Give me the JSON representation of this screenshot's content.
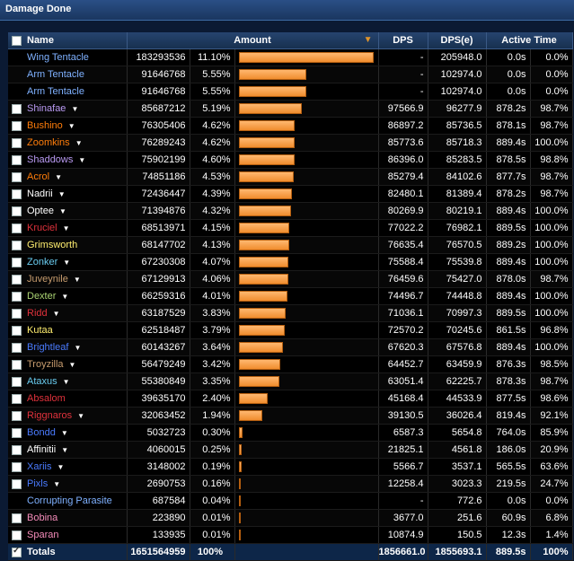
{
  "window": {
    "title": "Damage Done"
  },
  "columns": {
    "name": "Name",
    "amount": "Amount",
    "dps": "DPS",
    "dpse": "DPS(e)",
    "active": "Active Time"
  },
  "max_amount": 183293536,
  "rows": [
    {
      "name": "Wing Tentacle",
      "color": "#7fb1ff",
      "checkbox": false,
      "menu": false,
      "amount": "183293536",
      "pct": "11.10%",
      "value": 183293536,
      "dps": "-",
      "dpse": "205948.0",
      "time": "0.0s",
      "active": "0.0%"
    },
    {
      "name": "Arm Tentacle",
      "color": "#7fb1ff",
      "checkbox": false,
      "menu": false,
      "amount": "91646768",
      "pct": "5.55%",
      "value": 91646768,
      "dps": "-",
      "dpse": "102974.0",
      "time": "0.0s",
      "active": "0.0%"
    },
    {
      "name": "Arm Tentacle",
      "color": "#7fb1ff",
      "checkbox": false,
      "menu": false,
      "amount": "91646768",
      "pct": "5.55%",
      "value": 91646768,
      "dps": "-",
      "dpse": "102974.0",
      "time": "0.0s",
      "active": "0.0%"
    },
    {
      "name": "Shinafae",
      "color": "#b99af2",
      "checkbox": true,
      "menu": true,
      "amount": "85687212",
      "pct": "5.19%",
      "value": 85687212,
      "dps": "97566.9",
      "dpse": "96277.9",
      "time": "878.2s",
      "active": "98.7%"
    },
    {
      "name": "Bushino",
      "color": "#ff7d0a",
      "checkbox": true,
      "menu": true,
      "amount": "76305406",
      "pct": "4.62%",
      "value": 76305406,
      "dps": "86897.2",
      "dpse": "85736.5",
      "time": "878.1s",
      "active": "98.7%"
    },
    {
      "name": "Zoomkins",
      "color": "#ff7d0a",
      "checkbox": true,
      "menu": true,
      "amount": "76289243",
      "pct": "4.62%",
      "value": 76289243,
      "dps": "85773.6",
      "dpse": "85718.3",
      "time": "889.4s",
      "active": "100.0%"
    },
    {
      "name": "Shaddows",
      "color": "#b99af2",
      "checkbox": true,
      "menu": true,
      "amount": "75902199",
      "pct": "4.60%",
      "value": 75902199,
      "dps": "86396.0",
      "dpse": "85283.5",
      "time": "878.5s",
      "active": "98.8%"
    },
    {
      "name": "Acrol",
      "color": "#ff7d0a",
      "checkbox": true,
      "menu": true,
      "amount": "74851186",
      "pct": "4.53%",
      "value": 74851186,
      "dps": "85279.4",
      "dpse": "84102.6",
      "time": "877.7s",
      "active": "98.7%"
    },
    {
      "name": "Nadrii",
      "color": "#ffffff",
      "checkbox": true,
      "menu": true,
      "amount": "72436447",
      "pct": "4.39%",
      "value": 72436447,
      "dps": "82480.1",
      "dpse": "81389.4",
      "time": "878.2s",
      "active": "98.7%"
    },
    {
      "name": "Optee",
      "color": "#ffffff",
      "checkbox": true,
      "menu": true,
      "amount": "71394876",
      "pct": "4.32%",
      "value": 71394876,
      "dps": "80269.9",
      "dpse": "80219.1",
      "time": "889.4s",
      "active": "100.0%"
    },
    {
      "name": "Kruciel",
      "color": "#e0323c",
      "checkbox": true,
      "menu": true,
      "amount": "68513971",
      "pct": "4.15%",
      "value": 68513971,
      "dps": "77022.2",
      "dpse": "76982.1",
      "time": "889.5s",
      "active": "100.0%"
    },
    {
      "name": "Grimsworth",
      "color": "#ffee6f",
      "checkbox": true,
      "menu": false,
      "amount": "68147702",
      "pct": "4.13%",
      "value": 68147702,
      "dps": "76635.4",
      "dpse": "76570.5",
      "time": "889.2s",
      "active": "100.0%"
    },
    {
      "name": "Zonker",
      "color": "#69ccf0",
      "checkbox": true,
      "menu": true,
      "amount": "67230308",
      "pct": "4.07%",
      "value": 67230308,
      "dps": "75588.4",
      "dpse": "75539.8",
      "time": "889.4s",
      "active": "100.0%"
    },
    {
      "name": "Juveynile",
      "color": "#c79c6e",
      "checkbox": true,
      "menu": true,
      "amount": "67129913",
      "pct": "4.06%",
      "value": 67129913,
      "dps": "76459.6",
      "dpse": "75427.0",
      "time": "878.0s",
      "active": "98.7%"
    },
    {
      "name": "Dexter",
      "color": "#abd473",
      "checkbox": true,
      "menu": true,
      "amount": "66259316",
      "pct": "4.01%",
      "value": 66259316,
      "dps": "74496.7",
      "dpse": "74448.8",
      "time": "889.4s",
      "active": "100.0%"
    },
    {
      "name": "Ridd",
      "color": "#e0323c",
      "checkbox": true,
      "menu": true,
      "amount": "63187529",
      "pct": "3.83%",
      "value": 63187529,
      "dps": "71036.1",
      "dpse": "70997.3",
      "time": "889.5s",
      "active": "100.0%"
    },
    {
      "name": "Kutaa",
      "color": "#ffee6f",
      "checkbox": true,
      "menu": false,
      "amount": "62518487",
      "pct": "3.79%",
      "value": 62518487,
      "dps": "72570.2",
      "dpse": "70245.6",
      "time": "861.5s",
      "active": "96.8%"
    },
    {
      "name": "Brightleaf",
      "color": "#4a7bff",
      "checkbox": true,
      "menu": true,
      "amount": "60143267",
      "pct": "3.64%",
      "value": 60143267,
      "dps": "67620.3",
      "dpse": "67576.8",
      "time": "889.4s",
      "active": "100.0%"
    },
    {
      "name": "Troyzilla",
      "color": "#c79c6e",
      "checkbox": true,
      "menu": true,
      "amount": "56479249",
      "pct": "3.42%",
      "value": 56479249,
      "dps": "64452.7",
      "dpse": "63459.9",
      "time": "876.3s",
      "active": "98.5%"
    },
    {
      "name": "Ataxus",
      "color": "#69ccf0",
      "checkbox": true,
      "menu": true,
      "amount": "55380849",
      "pct": "3.35%",
      "value": 55380849,
      "dps": "63051.4",
      "dpse": "62225.7",
      "time": "878.3s",
      "active": "98.7%"
    },
    {
      "name": "Absalom",
      "color": "#e0323c",
      "checkbox": true,
      "menu": false,
      "amount": "39635170",
      "pct": "2.40%",
      "value": 39635170,
      "dps": "45168.4",
      "dpse": "44533.9",
      "time": "877.5s",
      "active": "98.6%"
    },
    {
      "name": "Riggnaros",
      "color": "#e0323c",
      "checkbox": true,
      "menu": true,
      "amount": "32063452",
      "pct": "1.94%",
      "value": 32063452,
      "dps": "39130.5",
      "dpse": "36026.4",
      "time": "819.4s",
      "active": "92.1%"
    },
    {
      "name": "Bondd",
      "color": "#4a7bff",
      "checkbox": true,
      "menu": true,
      "amount": "5032723",
      "pct": "0.30%",
      "value": 5032723,
      "dps": "6587.3",
      "dpse": "5654.8",
      "time": "764.0s",
      "active": "85.9%"
    },
    {
      "name": "Affinitii",
      "color": "#ffffff",
      "checkbox": true,
      "menu": true,
      "amount": "4060015",
      "pct": "0.25%",
      "value": 4060015,
      "dps": "21825.1",
      "dpse": "4561.8",
      "time": "186.0s",
      "active": "20.9%"
    },
    {
      "name": "Xariis",
      "color": "#4a7bff",
      "checkbox": true,
      "menu": true,
      "amount": "3148002",
      "pct": "0.19%",
      "value": 3148002,
      "dps": "5566.7",
      "dpse": "3537.1",
      "time": "565.5s",
      "active": "63.6%"
    },
    {
      "name": "Pixls",
      "color": "#4a7bff",
      "checkbox": true,
      "menu": true,
      "amount": "2690753",
      "pct": "0.16%",
      "value": 2690753,
      "dps": "12258.4",
      "dpse": "3023.3",
      "time": "219.5s",
      "active": "24.7%"
    },
    {
      "name": "Corrupting Parasite",
      "color": "#7fb1ff",
      "checkbox": false,
      "menu": false,
      "amount": "687584",
      "pct": "0.04%",
      "value": 687584,
      "dps": "-",
      "dpse": "772.6",
      "time": "0.0s",
      "active": "0.0%"
    },
    {
      "name": "Bobina",
      "color": "#f58cba",
      "checkbox": true,
      "menu": false,
      "amount": "223890",
      "pct": "0.01%",
      "value": 223890,
      "dps": "3677.0",
      "dpse": "251.6",
      "time": "60.9s",
      "active": "6.8%"
    },
    {
      "name": "Sparan",
      "color": "#f58cba",
      "checkbox": true,
      "menu": false,
      "amount": "133935",
      "pct": "0.01%",
      "value": 133935,
      "dps": "10874.9",
      "dpse": "150.5",
      "time": "12.3s",
      "active": "1.4%"
    }
  ],
  "totals": {
    "name": "Totals",
    "amount": "1651564959",
    "pct": "100%",
    "dps": "1856661.0",
    "dpse": "1855693.1",
    "time": "889.5s",
    "active": "100%"
  }
}
